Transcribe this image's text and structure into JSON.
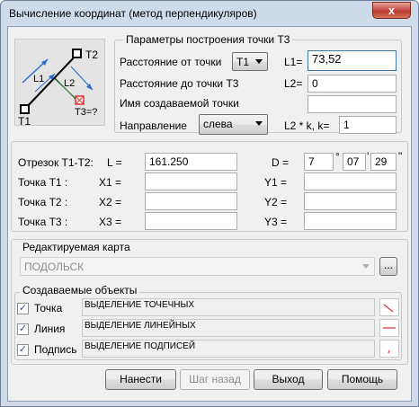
{
  "window": {
    "title": "Вычисление координат (метод перпендикуляров)",
    "close_glyph": "x"
  },
  "diagram": {
    "t1": "T1",
    "t2": "T2",
    "t3": "T3=?",
    "l1": "L1",
    "l2": "L2"
  },
  "params": {
    "group_title": "Параметры построения точки Т3",
    "dist_from_label": "Расстояние от точки",
    "dist_from_point": "T1",
    "l1_label": "L1=",
    "l1_value": "73,52",
    "dist_to_label": "Расстояние до точки Т3",
    "l2_label": "L2=",
    "l2_value": "0",
    "name_label": "Имя создаваемой точки",
    "name_value": "",
    "direction_label": "Направление",
    "direction_value": "слева",
    "k_label": "L2 * k, k=",
    "k_value": "1"
  },
  "segment": {
    "segment_label": "Отрезок Т1-Т2:",
    "l_label": "L =",
    "l_value": "161.250",
    "d_label": "D =",
    "deg": "7",
    "deg_sym": "°",
    "min": "07",
    "min_sym": "'",
    "sec": "29",
    "sec_sym": "\"",
    "t1_label": "Точка Т1 :",
    "t2_label": "Точка Т2 :",
    "t3_label": "Точка Т3 :",
    "x1_label": "X1 =",
    "x2_label": "X2 =",
    "x3_label": "X3 =",
    "y1_label": "Y1 =",
    "y2_label": "Y2 =",
    "y3_label": "Y3 =",
    "x1": "",
    "x2": "",
    "x3": "",
    "y1": "",
    "y2": "",
    "y3": ""
  },
  "map": {
    "group_title": "Редактируемая карта",
    "value": "ПОДОЛЬСК",
    "browse_label": "..."
  },
  "objects": {
    "group_title": "Создаваемые объекты",
    "items": [
      {
        "label": "Точка",
        "checked": true,
        "style": "ВЫДЕЛЕНИЕ ТОЧЕЧНЫХ"
      },
      {
        "label": "Линия",
        "checked": true,
        "style": "ВЫДЕЛЕНИЕ ЛИНЕЙНЫХ"
      },
      {
        "label": "Подпись",
        "checked": true,
        "style": "ВЫДЕЛЕНИЕ ПОДПИСЕЙ"
      }
    ],
    "check_glyph": "✓"
  },
  "buttons": {
    "apply": "Нанести",
    "back": "Шаг назад",
    "exit": "Выход",
    "help": "Помощь"
  },
  "colors": {
    "accent_red": "#e03030",
    "diagram_blue": "#2a6fd0",
    "diagram_green": "#2a9a3a"
  }
}
